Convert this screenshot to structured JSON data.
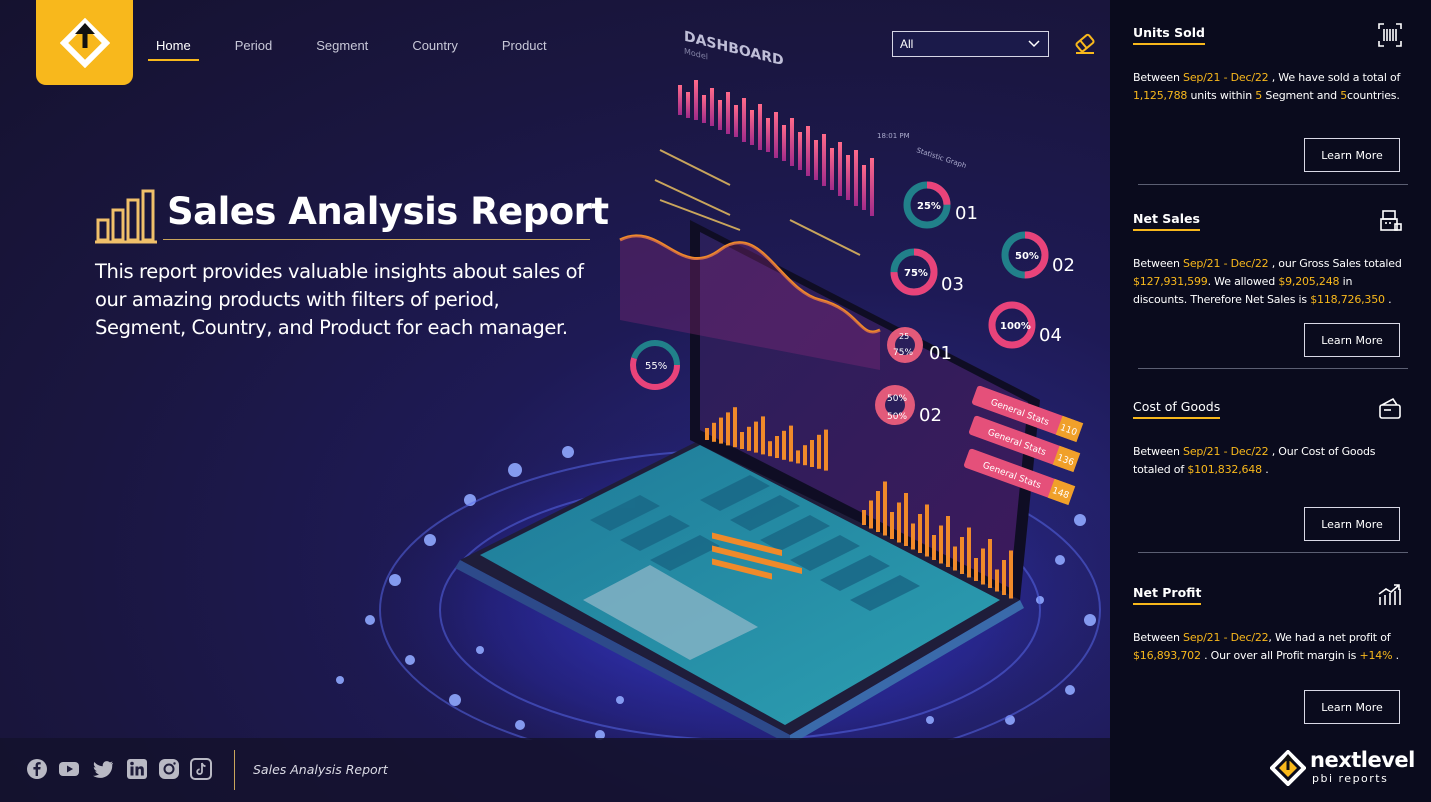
{
  "nav": {
    "items": [
      {
        "label": "Home",
        "active": true
      },
      {
        "label": "Period"
      },
      {
        "label": "Segment"
      },
      {
        "label": "Country"
      },
      {
        "label": "Product"
      }
    ],
    "filter_value": "All"
  },
  "hero": {
    "title": "Sales Analysis Report",
    "description": "This report provides valuable insights about sales of our amazing products with filters of period, Segment, Country, and Product for each manager."
  },
  "cards": {
    "units": {
      "title": "Units Sold",
      "icon": "barcode-icon",
      "t1": "Between ",
      "period": "Sep/21 - Dec/22",
      "t2": " , We have sold a total of ",
      "units": "1,125,788",
      "t3": " units within ",
      "segments": "5",
      "t4": " Segment and ",
      "countries": "5",
      "t5": "countries.",
      "button": "Learn More"
    },
    "net_sales": {
      "title": "Net Sales",
      "icon": "cash-register-icon",
      "t1": "Between ",
      "period": "Sep/21 - Dec/22",
      "t2": " , our Gross Sales totaled ",
      "gross": "$127,931,599",
      "t3": ". We allowed ",
      "discount": "$9,205,248",
      "t4": " in discounts. Therefore Net Sales is ",
      "net": "$118,726,350",
      "t5": " .",
      "button": "Learn More"
    },
    "cogs": {
      "title": "Cost of Goods",
      "icon": "wallet-icon",
      "t1": "Between ",
      "period": "Sep/21 - Dec/22",
      "t2": " , Our Cost of Goods totaled of ",
      "cost": "$101,832,648",
      "t3": " .",
      "button": "Learn More"
    },
    "profit": {
      "title": "Net Profit",
      "icon": "growth-chart-icon",
      "t1": "Between ",
      "period": "Sep/21 - Dec/22",
      "t2": ", We had a net profit of ",
      "profit": "$16,893,702",
      "t3": " . Our over all Profit margin is ",
      "margin": "+14%",
      "t4": " .",
      "button": "Learn More"
    }
  },
  "illustration": {
    "dashboard_title": "DASHBOARD",
    "dashboard_subtitle": "Model",
    "stat_label": "Statistic Graph",
    "time": "18:01 PM",
    "donuts": [
      {
        "value": "25%",
        "num": "01"
      },
      {
        "value": "50%",
        "num": "02"
      },
      {
        "value": "75%",
        "num": "03"
      },
      {
        "value": "100%",
        "num": "04"
      }
    ],
    "badges": [
      {
        "label": "General Stats",
        "value": "110"
      },
      {
        "label": "General Stats",
        "value": "136"
      },
      {
        "label": "General Stats",
        "value": "148"
      }
    ],
    "screen_labels": {
      "a": "25",
      "b": "75%",
      "c": "50%",
      "d": "50%",
      "e": "01",
      "f": "02",
      "g": "55%"
    }
  },
  "footer": {
    "title": "Sales Analysis Report",
    "social": [
      "facebook-icon",
      "youtube-icon",
      "twitter-icon",
      "linkedin-icon",
      "instagram-icon",
      "tiktok-icon"
    ],
    "brand_top": "nextlevel",
    "brand_bottom": "pbi reports"
  },
  "colors": {
    "accent": "#f8b81c",
    "panel": "#0a0b1d",
    "background": "#1b1740"
  }
}
